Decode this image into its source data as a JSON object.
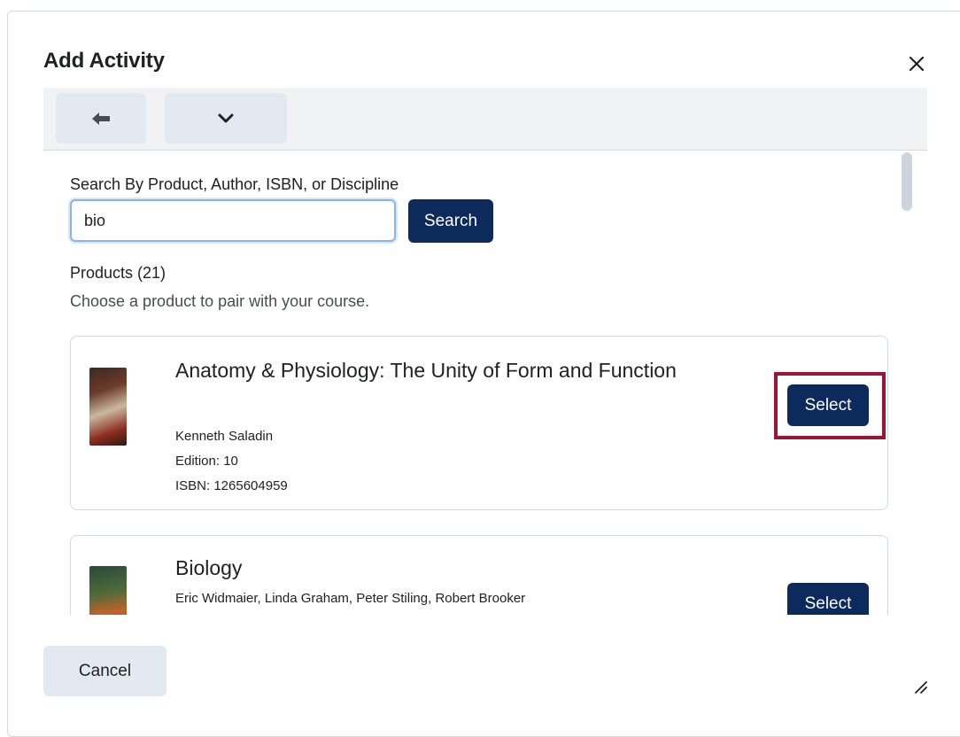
{
  "dialog": {
    "title": "Add Activity",
    "close_icon": "close-icon"
  },
  "toolbar": {
    "back_icon": "arrow-left-icon",
    "more_icon": "chevron-down-icon"
  },
  "search": {
    "label": "Search By Product, Author, ISBN, or Discipline",
    "value": "bio",
    "button_label": "Search"
  },
  "products": {
    "heading": "Products (21)",
    "subtitle": "Choose a product to pair with your course.",
    "items": [
      {
        "title": "Anatomy & Physiology: The Unity of Form and Function",
        "author": "Kenneth Saladin",
        "edition": "Edition: 10",
        "isbn": "ISBN: 1265604959",
        "select_label": "Select"
      },
      {
        "title": "Biology",
        "author": "Eric Widmaier, Linda Graham, Peter Stiling, Robert Brooker",
        "select_label": "Select"
      }
    ]
  },
  "footer": {
    "cancel_label": "Cancel",
    "resize_icon": "resize-handle-icon"
  },
  "colors": {
    "primary_button": "#0c2a5c",
    "secondary_button": "#e3e9f1",
    "highlight": "#9a1536",
    "focus_border": "#8ab4e8"
  }
}
